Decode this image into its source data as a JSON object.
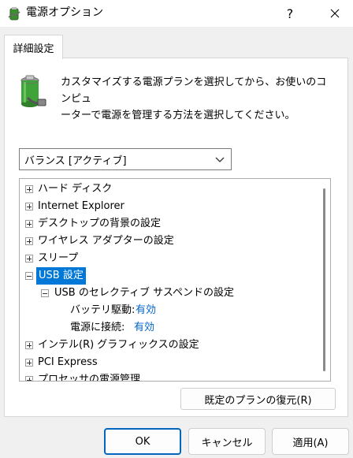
{
  "window": {
    "title": "電源オプション",
    "help_label": "?",
    "close_icon": "close-icon"
  },
  "tabs": [
    {
      "label": "詳細設定",
      "active": true
    }
  ],
  "description": "カスタマイズする電源プランを選択してから、お使いのコンピュ\nーターで電源を管理する方法を選択してください。",
  "plan_select": {
    "value": "バランス [アクティブ]"
  },
  "tree": {
    "items": [
      {
        "label": "ハード ディスク",
        "level": 0,
        "expander": "plus"
      },
      {
        "label": "Internet Explorer",
        "level": 0,
        "expander": "plus"
      },
      {
        "label": "デスクトップの背景の設定",
        "level": 0,
        "expander": "plus"
      },
      {
        "label": "ワイヤレス アダプターの設定",
        "level": 0,
        "expander": "plus"
      },
      {
        "label": "スリープ",
        "level": 0,
        "expander": "plus"
      },
      {
        "label": "USB 設定",
        "level": 0,
        "expander": "minus",
        "selected": true
      },
      {
        "label": "USB のセレクティブ サスペンドの設定",
        "level": 1,
        "expander": "minus"
      },
      {
        "label": "バッテリ駆動:",
        "level": 2,
        "value": "有効"
      },
      {
        "label": "電源に接続:",
        "level": 2,
        "value": "有効"
      },
      {
        "label": "インテル(R) グラフィックスの設定",
        "level": 0,
        "expander": "plus"
      },
      {
        "label": "PCI Express",
        "level": 0,
        "expander": "plus"
      },
      {
        "label": "プロセッサの電源管理",
        "level": 0,
        "expander": "plus"
      }
    ]
  },
  "buttons": {
    "restore_defaults": "既定のプランの復元(R)",
    "ok": "OK",
    "cancel": "キャンセル",
    "apply": "適用(A)"
  },
  "colors": {
    "selection": "#0078d7",
    "link_value": "#0066cc",
    "ok_border": "#0067c0"
  }
}
